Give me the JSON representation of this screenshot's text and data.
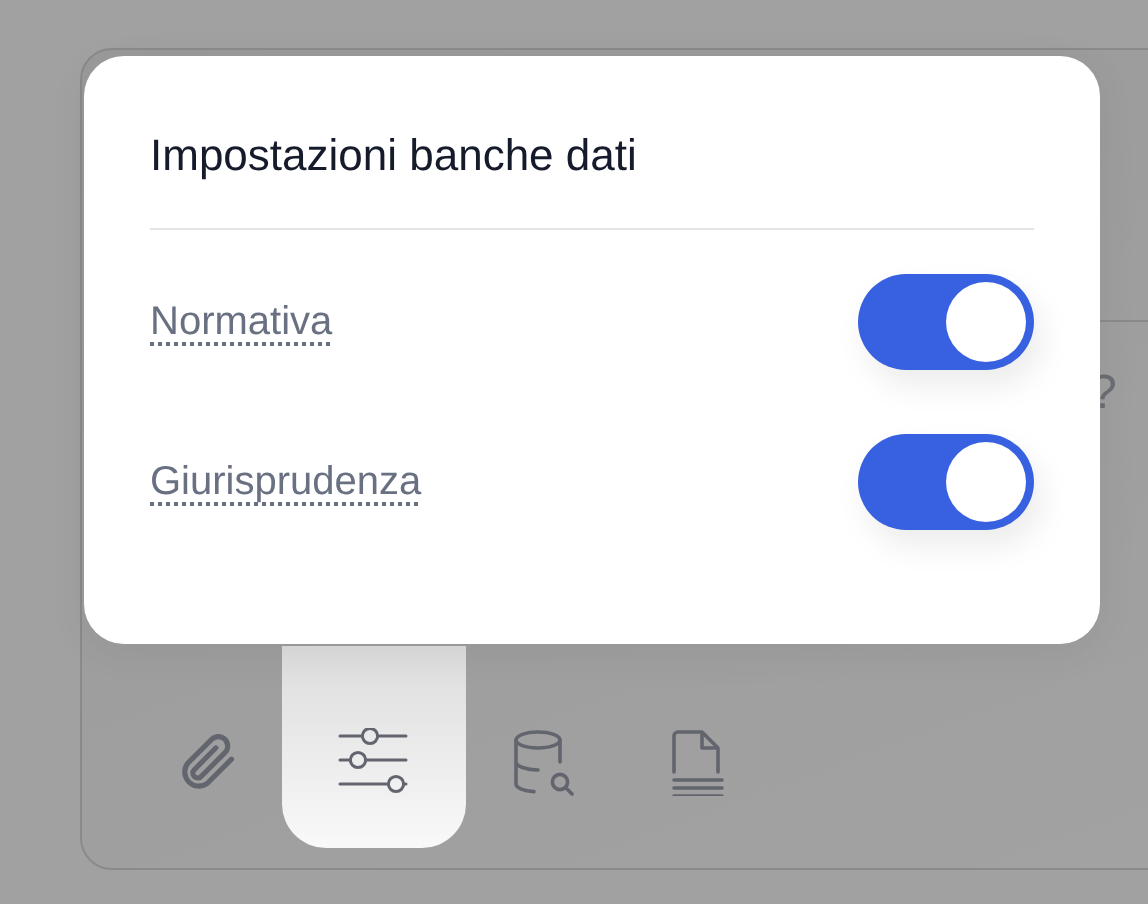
{
  "dialog": {
    "title": "Impostazioni banche dati",
    "options": [
      {
        "label": "Normativa",
        "on": true
      },
      {
        "label": "Giurisprudenza",
        "on": true
      }
    ]
  },
  "background": {
    "partial_text": "?"
  },
  "toolbar": [
    {
      "kind": "paperclip",
      "selected": false
    },
    {
      "kind": "sliders",
      "selected": true
    },
    {
      "kind": "database-search",
      "selected": false
    },
    {
      "kind": "document",
      "selected": false
    }
  ]
}
